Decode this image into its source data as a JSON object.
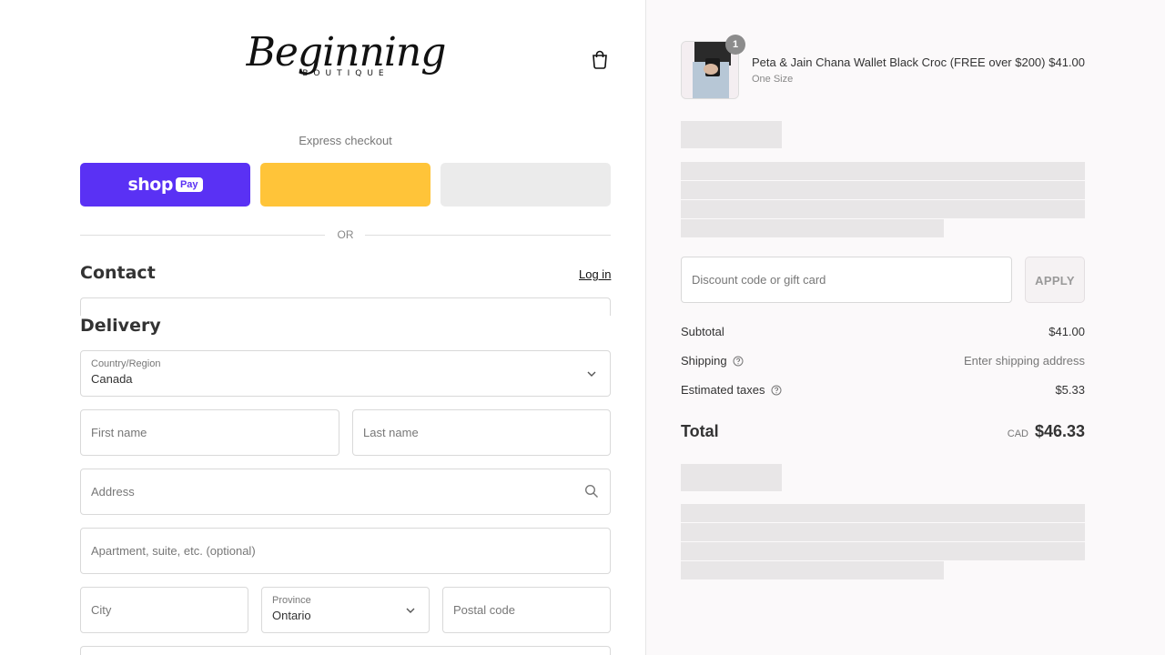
{
  "logo": {
    "main": "Beginning",
    "sub": "BOUTIQUE"
  },
  "express": {
    "title": "Express checkout",
    "shoppay_word": "shop",
    "shoppay_pay": "Pay",
    "or_label": "OR"
  },
  "contact": {
    "title": "Contact",
    "login_label": "Log in"
  },
  "delivery": {
    "title": "Delivery",
    "country": {
      "label": "Country/Region",
      "value": "Canada"
    },
    "first_name_placeholder": "First name",
    "last_name_placeholder": "Last name",
    "address_placeholder": "Address",
    "apartment_placeholder": "Apartment, suite, etc. (optional)",
    "city_placeholder": "City",
    "province": {
      "label": "Province",
      "value": "Ontario"
    },
    "postal_placeholder": "Postal code"
  },
  "cart": {
    "item": {
      "quantity": "1",
      "name": "Peta & Jain Chana Wallet Black Croc (FREE over $200)",
      "variant": "One Size",
      "price": "$41.00"
    },
    "discount_placeholder": "Discount code or gift card",
    "apply_label": "APPLY",
    "subtotal_label": "Subtotal",
    "subtotal_value": "$41.00",
    "shipping_label": "Shipping",
    "shipping_value": "Enter shipping address",
    "taxes_label": "Estimated taxes",
    "taxes_value": "$5.33",
    "total_label": "Total",
    "total_currency": "CAD",
    "total_value": "$46.33"
  },
  "colors": {
    "shoppay": "#5a31f4",
    "paypal": "#ffc439",
    "gpay": "#ebebeb",
    "summary_bg": "#fbf9fa"
  },
  "icons": [
    "shopping-bag-icon",
    "chevron-down-icon",
    "search-icon",
    "help-circle-icon"
  ]
}
